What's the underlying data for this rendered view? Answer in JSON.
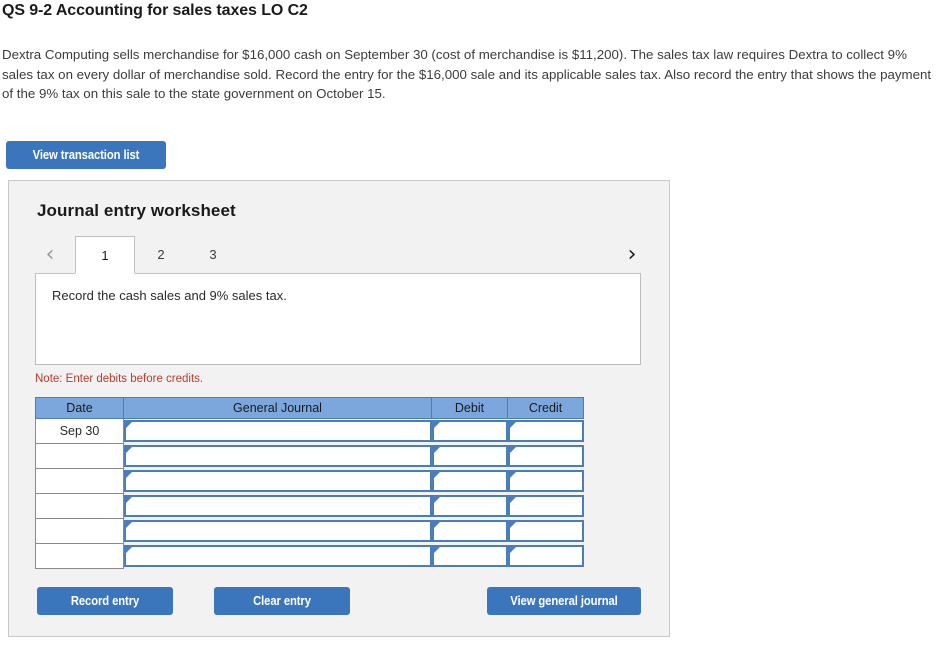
{
  "question": {
    "title": "QS 9-2 Accounting for sales taxes LO C2",
    "body": "Dextra Computing sells merchandise for $16,000 cash on September 30 (cost of merchandise is $11,200). The sales tax law requires Dextra to collect 9% sales tax on every dollar of merchandise sold. Record the entry for the $16,000 sale and its applicable sales tax. Also record the entry that shows the payment of the 9% tax on this sale to the state government on October 15."
  },
  "toolbar": {
    "view_transaction_list_label": "View transaction list"
  },
  "worksheet": {
    "heading": "Journal entry worksheet",
    "prev_icon": "chevron-left-icon",
    "next_icon": "chevron-right-icon",
    "prev_glyph": "‹",
    "next_glyph": "›",
    "tabs": [
      {
        "label": "1",
        "active": true
      },
      {
        "label": "2",
        "active": false
      },
      {
        "label": "3",
        "active": false
      }
    ],
    "description": "Record the cash sales and 9% sales tax.",
    "note": "Note: Enter debits before credits.",
    "table": {
      "columns": [
        "Date",
        "General Journal",
        "Debit",
        "Credit"
      ],
      "rows": [
        {
          "date": "Sep 30",
          "general_journal": "",
          "debit": "",
          "credit": ""
        },
        {
          "date": "",
          "general_journal": "",
          "debit": "",
          "credit": ""
        },
        {
          "date": "",
          "general_journal": "",
          "debit": "",
          "credit": ""
        },
        {
          "date": "",
          "general_journal": "",
          "debit": "",
          "credit": ""
        },
        {
          "date": "",
          "general_journal": "",
          "debit": "",
          "credit": ""
        },
        {
          "date": "",
          "general_journal": "",
          "debit": "",
          "credit": ""
        }
      ]
    },
    "buttons": {
      "record_entry": "Record entry",
      "clear_entry": "Clear entry",
      "view_general_journal": "View general journal"
    }
  },
  "colors": {
    "button_blue": "#3b75bc",
    "table_header_blue": "#7ba7dd",
    "input_border_blue": "#4a7ebb",
    "panel_gray": "#f2f2f2",
    "note_red": "#c0392b"
  }
}
